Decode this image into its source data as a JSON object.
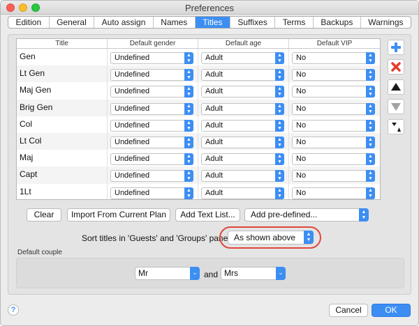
{
  "window": {
    "title": "Preferences"
  },
  "tabs": [
    {
      "label": "Edition",
      "active": false
    },
    {
      "label": "General",
      "active": false
    },
    {
      "label": "Auto assign",
      "active": false
    },
    {
      "label": "Names",
      "active": false
    },
    {
      "label": "Titles",
      "active": true
    },
    {
      "label": "Suffixes",
      "active": false
    },
    {
      "label": "Terms",
      "active": false
    },
    {
      "label": "Backups",
      "active": false
    },
    {
      "label": "Warnings",
      "active": false
    }
  ],
  "table": {
    "columns": [
      "Title",
      "Default gender",
      "Default age",
      "Default VIP"
    ],
    "rows": [
      {
        "title": "Gen",
        "gender": "Undefined",
        "age": "Adult",
        "vip": "No"
      },
      {
        "title": "Lt Gen",
        "gender": "Undefined",
        "age": "Adult",
        "vip": "No"
      },
      {
        "title": "Maj Gen",
        "gender": "Undefined",
        "age": "Adult",
        "vip": "No"
      },
      {
        "title": "Brig Gen",
        "gender": "Undefined",
        "age": "Adult",
        "vip": "No"
      },
      {
        "title": "Col",
        "gender": "Undefined",
        "age": "Adult",
        "vip": "No"
      },
      {
        "title": "Lt Col",
        "gender": "Undefined",
        "age": "Adult",
        "vip": "No"
      },
      {
        "title": "Maj",
        "gender": "Undefined",
        "age": "Adult",
        "vip": "No"
      },
      {
        "title": "Capt",
        "gender": "Undefined",
        "age": "Adult",
        "vip": "No"
      },
      {
        "title": "1Lt",
        "gender": "Undefined",
        "age": "Adult",
        "vip": "No"
      }
    ]
  },
  "side_buttons": [
    {
      "name": "add-title-button",
      "icon": "plus-icon"
    },
    {
      "name": "remove-title-button",
      "icon": "x-icon"
    },
    {
      "name": "move-up-button",
      "icon": "triangle-up-icon"
    },
    {
      "name": "move-down-button",
      "icon": "triangle-down-icon"
    },
    {
      "name": "sort-button",
      "icon": "sort-icon"
    }
  ],
  "actions": {
    "clear": "Clear",
    "import": "Import From Current Plan",
    "add_text_list": "Add Text List...",
    "add_predefined": "Add pre-defined..."
  },
  "sort": {
    "label": "Sort titles in 'Guests' and 'Groups' panes:",
    "value": "As shown above"
  },
  "couple": {
    "label": "Default couple",
    "first": "Mr",
    "and": "and",
    "second": "Mrs"
  },
  "footer": {
    "help": "?",
    "cancel": "Cancel",
    "ok": "OK"
  },
  "colors": {
    "accent": "#3d8ef3",
    "highlight_ring": "#e0473b"
  }
}
